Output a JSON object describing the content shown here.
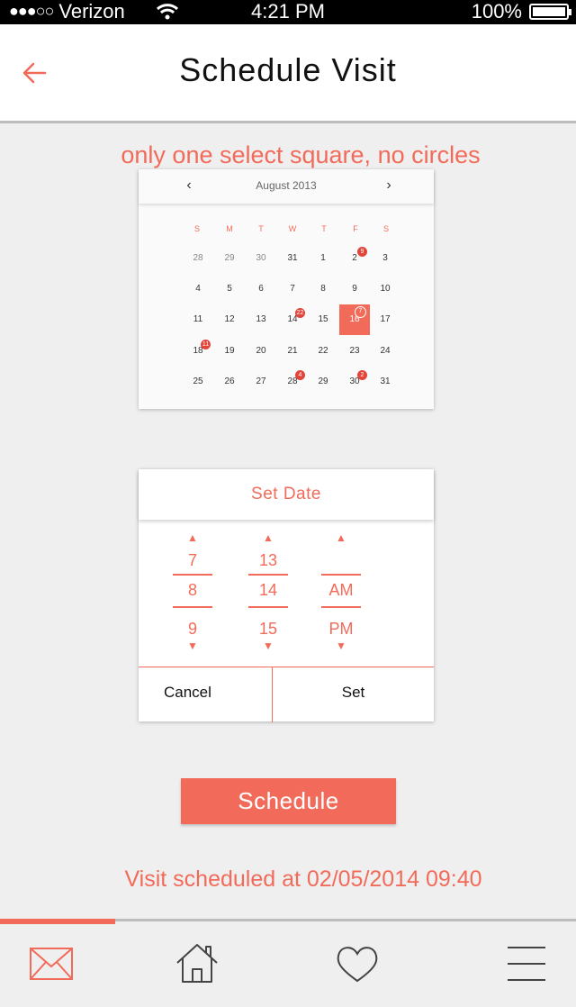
{
  "status_bar": {
    "signal": "●●●○○",
    "carrier": "Verizon",
    "time": "4:21 PM",
    "battery": "100%"
  },
  "header": {
    "title": "Schedule Visit",
    "back_icon": "arrow-left-icon"
  },
  "note": "only one select square, no circles",
  "calendar": {
    "month_label": "August 2013",
    "prev_icon": "‹",
    "next_icon": "›",
    "weekdays": [
      "S",
      "M",
      "T",
      "W",
      "T",
      "F",
      "S"
    ],
    "weeks": [
      [
        {
          "d": "28",
          "m": true
        },
        {
          "d": "29",
          "m": true
        },
        {
          "d": "30",
          "m": true
        },
        {
          "d": "31"
        },
        {
          "d": "1"
        },
        {
          "d": "2",
          "b": "9"
        },
        {
          "d": "3"
        }
      ],
      [
        {
          "d": "4"
        },
        {
          "d": "5"
        },
        {
          "d": "6"
        },
        {
          "d": "7"
        },
        {
          "d": "8"
        },
        {
          "d": "9"
        },
        {
          "d": "10"
        }
      ],
      [
        {
          "d": "11"
        },
        {
          "d": "12"
        },
        {
          "d": "13"
        },
        {
          "d": "14",
          "b": "22"
        },
        {
          "d": "15"
        },
        {
          "d": "16",
          "b": "7",
          "s": true
        },
        {
          "d": "17"
        }
      ],
      [
        {
          "d": "18",
          "b": "11"
        },
        {
          "d": "19"
        },
        {
          "d": "20"
        },
        {
          "d": "21"
        },
        {
          "d": "22"
        },
        {
          "d": "23"
        },
        {
          "d": "24"
        }
      ],
      [
        {
          "d": "25"
        },
        {
          "d": "26"
        },
        {
          "d": "27"
        },
        {
          "d": "28",
          "b": "4"
        },
        {
          "d": "29"
        },
        {
          "d": "30",
          "b": "2"
        },
        {
          "d": "31"
        }
      ]
    ]
  },
  "picker": {
    "title": "Set Date",
    "columns": [
      {
        "values": [
          "7",
          "8",
          "9"
        ],
        "has_down": true
      },
      {
        "values": [
          "13",
          "14",
          "15"
        ],
        "has_down": true
      },
      {
        "values": [
          "",
          "AM",
          "PM"
        ],
        "has_down": true
      }
    ],
    "cancel_label": "Cancel",
    "set_label": "Set"
  },
  "schedule_label": "Schedule",
  "confirmation": "Visit scheduled at 02/05/2014 09:40",
  "tabbar": {
    "items": [
      {
        "name": "mail-icon",
        "active": true
      },
      {
        "name": "home-icon",
        "active": false
      },
      {
        "name": "heart-icon",
        "active": false
      },
      {
        "name": "menu-icon",
        "active": false
      }
    ]
  },
  "colors": {
    "accent": "#f26b5a",
    "badge": "#e2453a",
    "background": "#efefef"
  }
}
